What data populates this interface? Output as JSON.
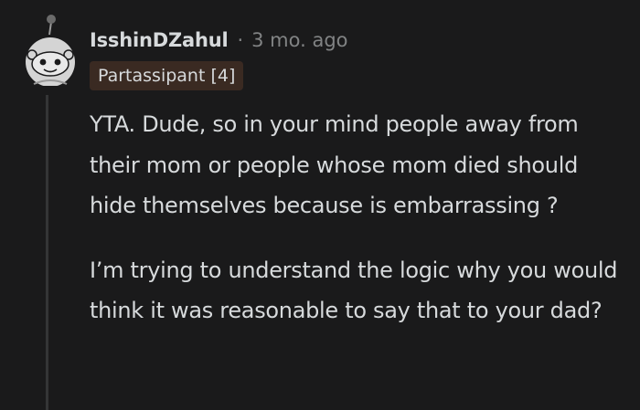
{
  "comment": {
    "author": "IsshinDZahul",
    "separator": "·",
    "timestamp": "3 mo. ago",
    "flair": "Partassipant [4]",
    "paragraphs": [
      "YTA. Dude, so in your mind people away from their mom or people whose mom died should hide themselves because is embarrassing ?",
      "I’m trying to understand the logic why you would think it was reasonable to say that to your dad?"
    ]
  },
  "colors": {
    "background": "#1a1a1b",
    "text": "#d7dadc",
    "meta": "#818384",
    "flair_bg": "#3a2a22",
    "thread_line": "#343536"
  },
  "icons": {
    "avatar": "snoo-avatar-icon"
  }
}
